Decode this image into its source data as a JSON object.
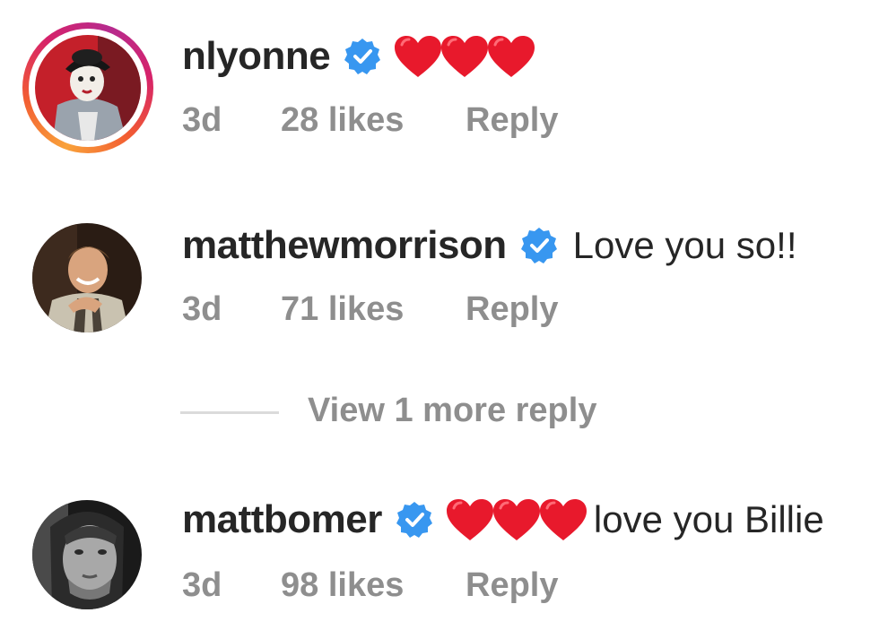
{
  "comments": [
    {
      "username": "nlyonne",
      "verified": true,
      "hearts": 3,
      "text": "",
      "age": "3d",
      "likes": "28 likes",
      "reply": "Reply",
      "story_ring": true
    },
    {
      "username": "matthewmorrison",
      "verified": true,
      "hearts": 0,
      "text": "Love you so!!",
      "age": "3d",
      "likes": "71 likes",
      "reply": "Reply",
      "story_ring": false
    },
    {
      "username": "mattbomer",
      "verified": true,
      "hearts": 3,
      "text": "love you Billie",
      "age": "3d",
      "likes": "98 likes",
      "reply": "Reply",
      "story_ring": false
    }
  ],
  "view_more": "View 1 more reply",
  "colors": {
    "text": "#262626",
    "secondary": "#8e8e8e",
    "verified": "#3897f0",
    "heart": "#e8192c"
  },
  "icons": {
    "verified": "verified-badge-icon",
    "heart": "red-heart-emoji-icon"
  }
}
